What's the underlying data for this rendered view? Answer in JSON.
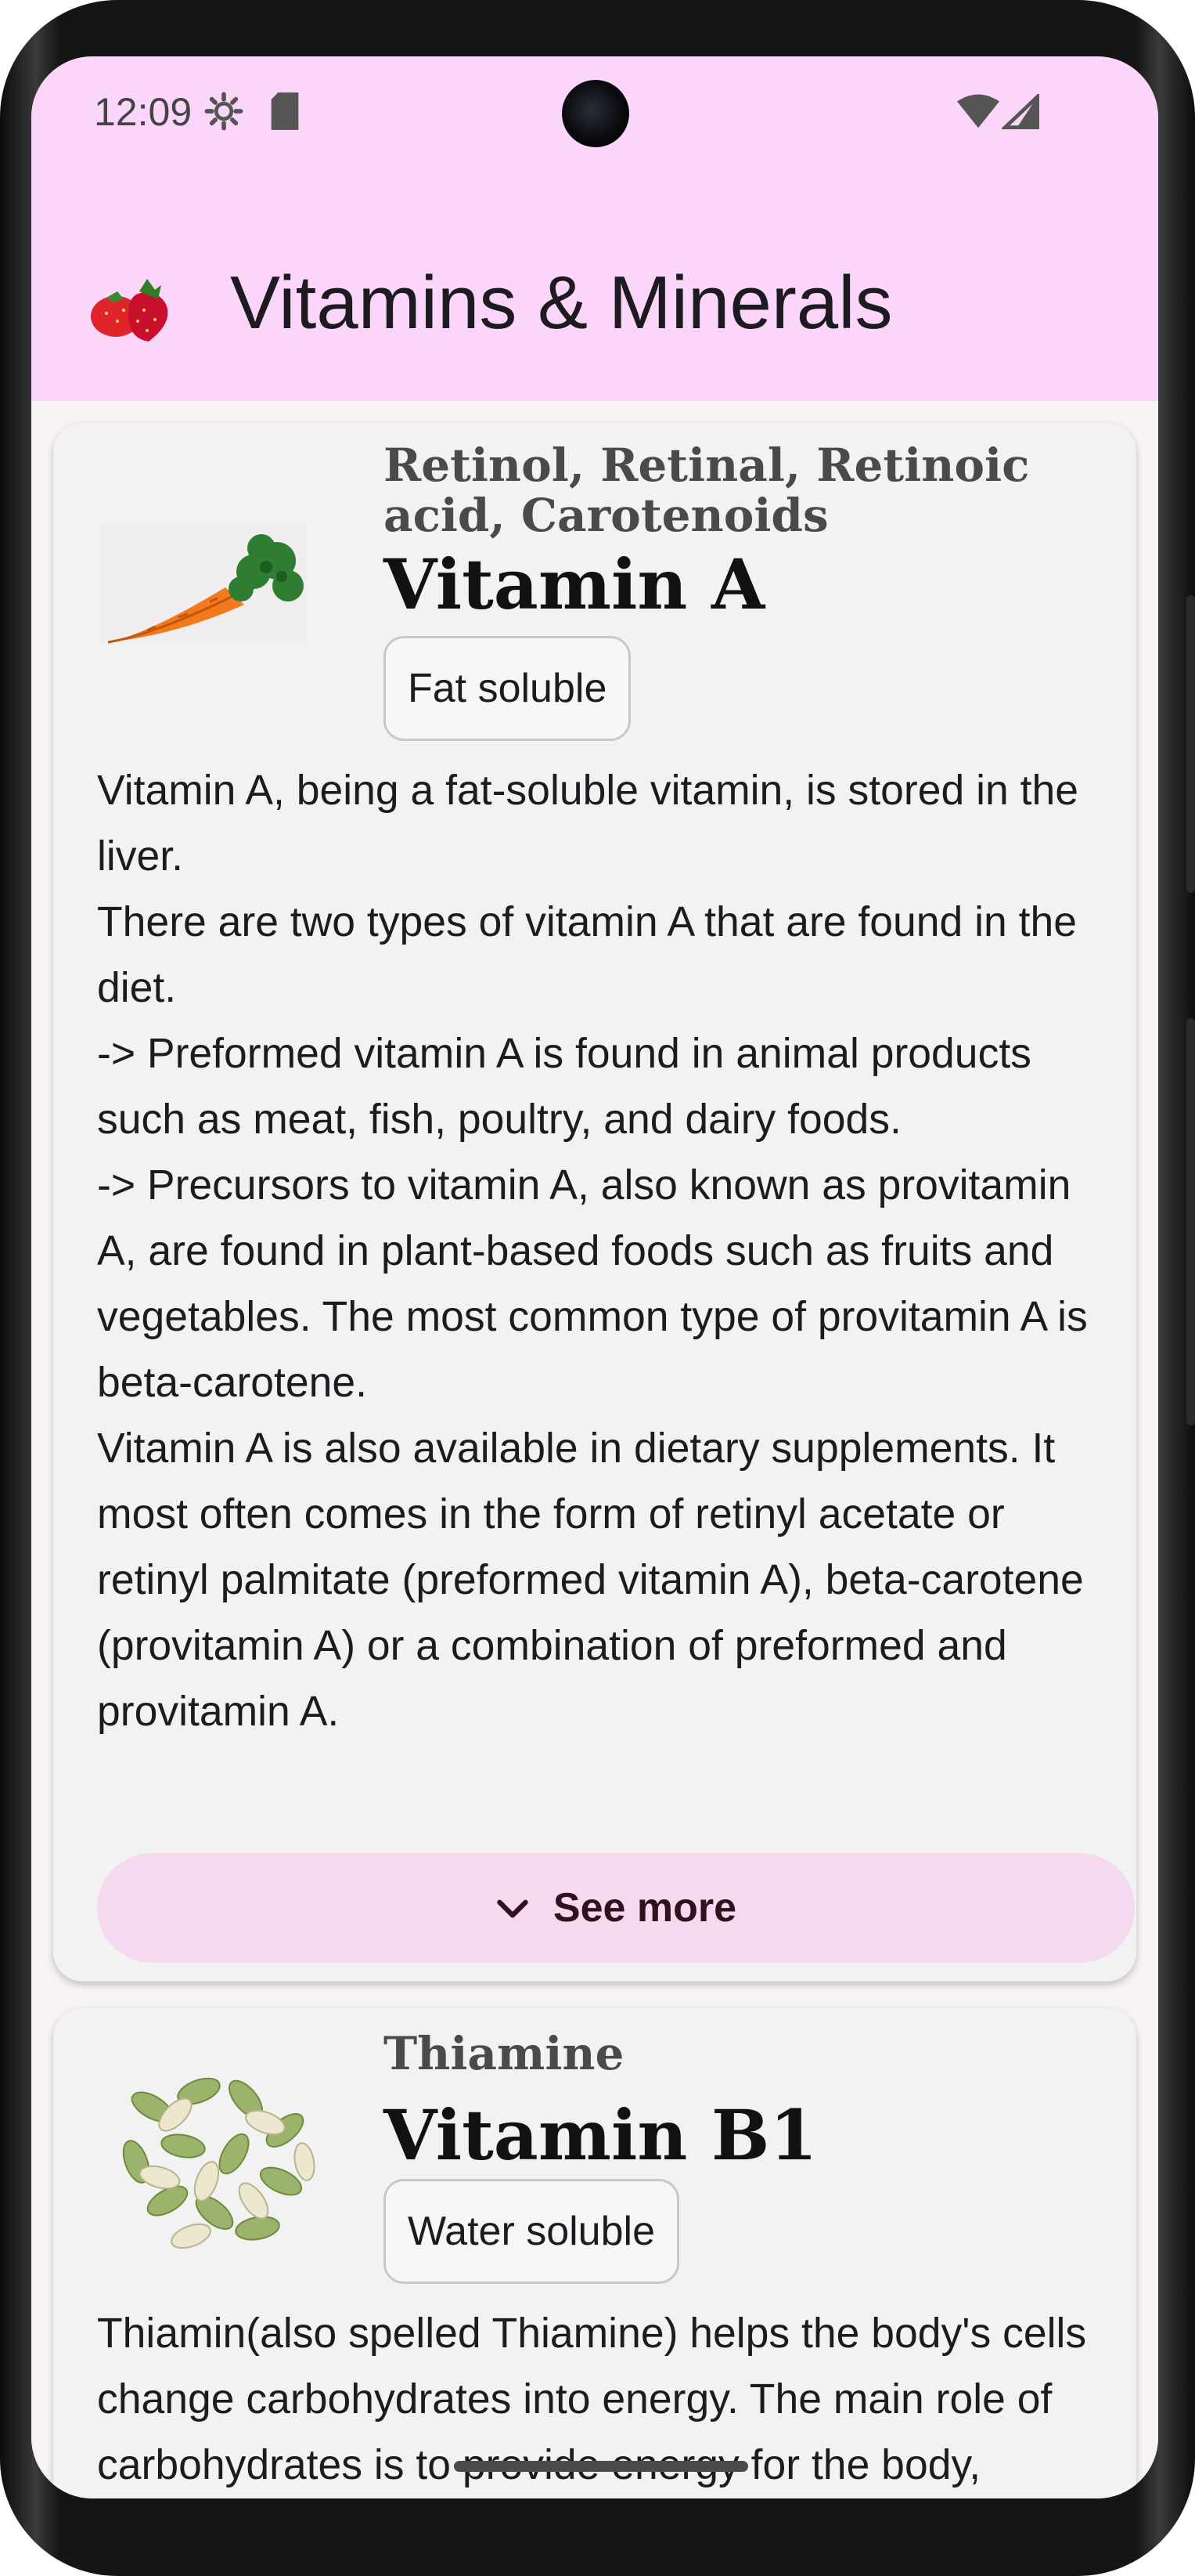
{
  "status_bar": {
    "time": "12:09",
    "icons": [
      "settings-icon",
      "sd-card-icon",
      "wifi-icon",
      "cell-signal-icon"
    ]
  },
  "app_bar": {
    "title": "Vitamins & Minerals",
    "logo_icon": "strawberry-icon"
  },
  "cards": [
    {
      "subname": "Retinol, Retinal, Retinoic acid, Carotenoids",
      "name": "Vitamin A",
      "chip": "Fat soluble",
      "image_icon": "carrot-icon",
      "description": "Vitamin A, being a fat-soluble vitamin, is stored in the liver.\nThere are two types of vitamin A that are found in the diet.\n-> Preformed vitamin A is found in animal products such as meat, fish, poultry, and dairy foods.\n-> Precursors to vitamin A, also known as provitamin A, are found in plant-based foods such as fruits and vegetables. The most common type of provitamin A is beta-carotene.\nVitamin A is also available in dietary supplements. It most often comes in the form of retinyl acetate or retinyl palmitate (preformed vitamin A), beta-carotene (provitamin A) or a combination of preformed and provitamin A.",
      "button": "See more"
    },
    {
      "subname": "Thiamine",
      "name": "Vitamin B1",
      "chip": "Water soluble",
      "image_icon": "seeds-icon",
      "description": "Thiamin(also spelled Thiamine) helps the body's cells change carbohydrates into energy. The main role of carbohydrates is to provide energy for the body, especially the brain and nervous system."
    }
  ],
  "colors": {
    "app_bar": "#fcd5fb",
    "card": "#f2f2f2",
    "see_more_button": "#f4d9ef",
    "text": "#1d1b20"
  }
}
